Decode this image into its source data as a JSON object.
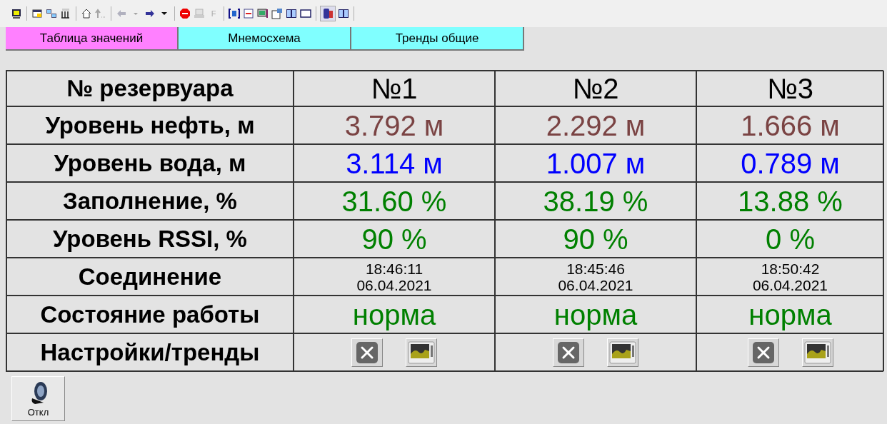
{
  "toolbar": {
    "f_button": {
      "label": "F",
      "disabled": true
    }
  },
  "tabs": [
    {
      "label": "Таблица значений",
      "selected": true
    },
    {
      "label": "Мнемосхема",
      "selected": false
    },
    {
      "label": "Тренды общие",
      "selected": false
    }
  ],
  "table": {
    "header": [
      "№ резервуара",
      "№1",
      "№2",
      "№3"
    ],
    "rows": [
      {
        "kind": "value",
        "label": "Уровень нефть, м",
        "color": "#7a4343",
        "cells": [
          "3.792 м",
          "2.292 м",
          "1.666 м"
        ]
      },
      {
        "kind": "value",
        "label": "Уровень вода, м",
        "color": "#0000ff",
        "cells": [
          "3.114 м",
          "1.007 м",
          "0.789 м"
        ]
      },
      {
        "kind": "value",
        "label": "Заполнение, %",
        "color": "#008000",
        "cells": [
          "31.60 %",
          "38.19 %",
          "13.88 %"
        ]
      },
      {
        "kind": "value",
        "label": "Уровень RSSI, %",
        "color": "#008000",
        "cells": [
          "90 %",
          "90 %",
          "0 %"
        ]
      },
      {
        "kind": "datetime",
        "label": "Соединение",
        "cells": [
          {
            "time": "18:46:11",
            "date": "06.04.2021"
          },
          {
            "time": "18:45:46",
            "date": "06.04.2021"
          },
          {
            "time": "18:50:42",
            "date": "06.04.2021"
          }
        ]
      },
      {
        "kind": "value",
        "label": "Состояние работы",
        "color": "#008000",
        "cells": [
          "норма",
          "норма",
          "норма"
        ]
      },
      {
        "kind": "actions",
        "label": "Настройки/тренды",
        "cells": [
          {
            "kind": "buttons"
          },
          {
            "kind": "buttons"
          },
          {
            "kind": "buttons"
          }
        ]
      }
    ]
  },
  "sound_button": {
    "label": "Откл"
  }
}
